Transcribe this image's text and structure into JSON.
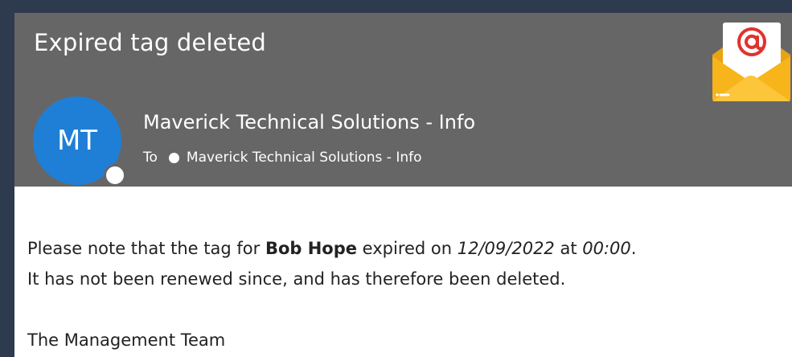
{
  "email": {
    "subject": "Expired tag deleted",
    "sender": {
      "initials": "MT",
      "name": "Maverick Technical Solutions - Info"
    },
    "to_label": "To",
    "recipient": "Maverick Technical Solutions - Info",
    "icon": "email-at-envelope-icon",
    "body": {
      "line1_prefix": "Please note that the tag for ",
      "person": "Bob Hope",
      "line1_mid": " expired on ",
      "date": "12/09/2022",
      "line1_at": " at ",
      "time": "00:00",
      "line1_end": ".",
      "line2": "It has not been renewed since, and has therefore been deleted.",
      "signature": "The Management Team"
    }
  },
  "colors": {
    "background": "#2e3a4e",
    "header": "#666666",
    "avatar": "#1f7fd6",
    "envelope": "#f7b51b",
    "at_symbol": "#e0322d"
  }
}
